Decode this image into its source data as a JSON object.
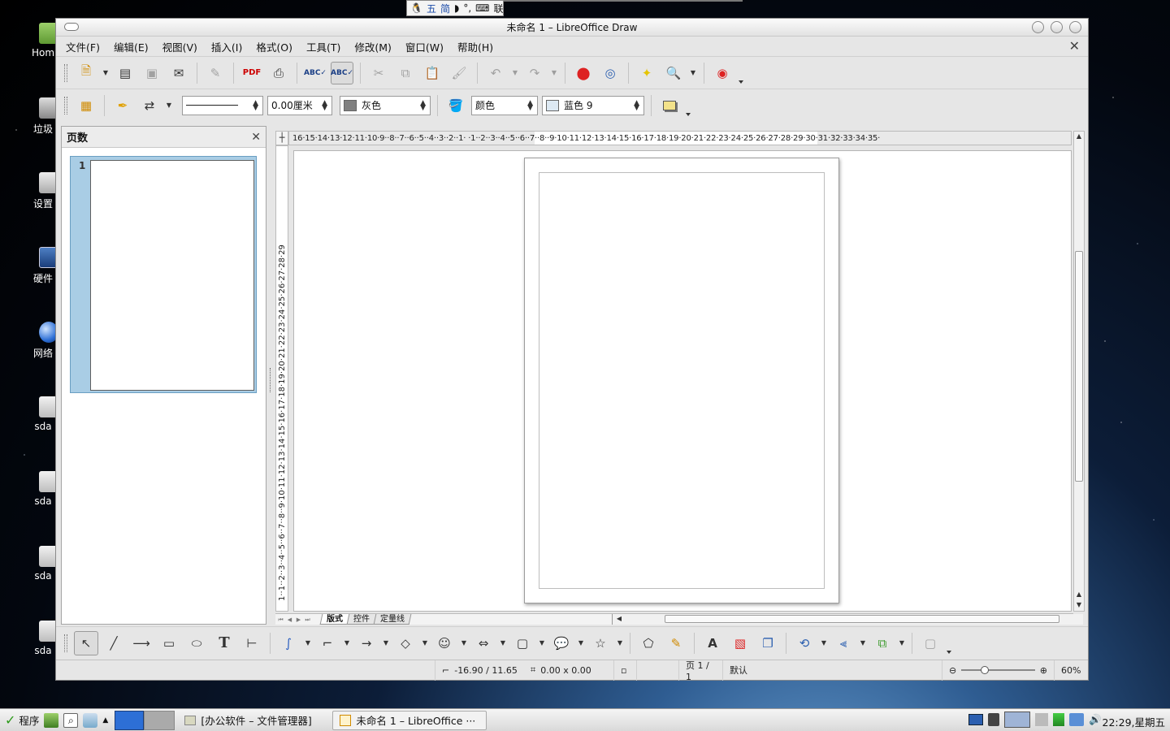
{
  "ime_bar": {
    "mode": "五",
    "script": "简",
    "kbd_label": "联"
  },
  "desktop_icons": [
    {
      "label": "Hom",
      "icon": "home-folder-icon"
    },
    {
      "label": "垃圾",
      "icon": "trash-icon"
    },
    {
      "label": "设置",
      "icon": "settings-icon"
    },
    {
      "label": "硬件",
      "icon": "hardware-icon"
    },
    {
      "label": "网络",
      "icon": "network-globe-icon"
    },
    {
      "label": "sda",
      "icon": "disk-icon"
    },
    {
      "label": "sda",
      "icon": "disk-icon"
    },
    {
      "label": "sda",
      "icon": "disk-icon"
    },
    {
      "label": "sda",
      "icon": "disk-icon"
    }
  ],
  "window": {
    "title": "未命名 1 – LibreOffice Draw"
  },
  "menu": [
    "文件(F)",
    "编辑(E)",
    "视图(V)",
    "插入(I)",
    "格式(O)",
    "工具(T)",
    "修改(M)",
    "窗口(W)",
    "帮助(H)"
  ],
  "line_toolbar": {
    "line_width": "0.00厘米",
    "line_color": "灰色",
    "area_style": "颜色",
    "area_color": "蓝色 9",
    "colors": {
      "line": "#808080",
      "area": "#dde9f3",
      "shadow": "#f3e28a"
    }
  },
  "panel": {
    "title": "页数",
    "slide_number": "1"
  },
  "ruler": {
    "horizontal": "16·15·14·13·12·11·10·9··8··7··6··5··4··3··2··1·  ·1··2··3··4··5··6··7··8··9·10·11·12·13·14·15·16·17·18·19·20·21·22·23·24·25·26·27·28·29·30·31·32·33·34·35·",
    "vertical": "1··1··2··3··4··5··6··7··8··9·10·11·12·13·14·15·16·17·18·19·20·21·22·23·24·25·26·27·28·29"
  },
  "tabs": [
    "版式",
    "控件",
    "定量线"
  ],
  "status": {
    "position": "-16.90 / 11.65",
    "size": "0.00 x 0.00",
    "page": "页 1 / 1",
    "master": "默认",
    "zoom": "60%"
  },
  "taskbar": {
    "start_label": "程序",
    "tasks": [
      "[办公软件 – 文件管理器]",
      "未命名 1 – LibreOffice ···"
    ],
    "clock": "22:29,星期五"
  }
}
